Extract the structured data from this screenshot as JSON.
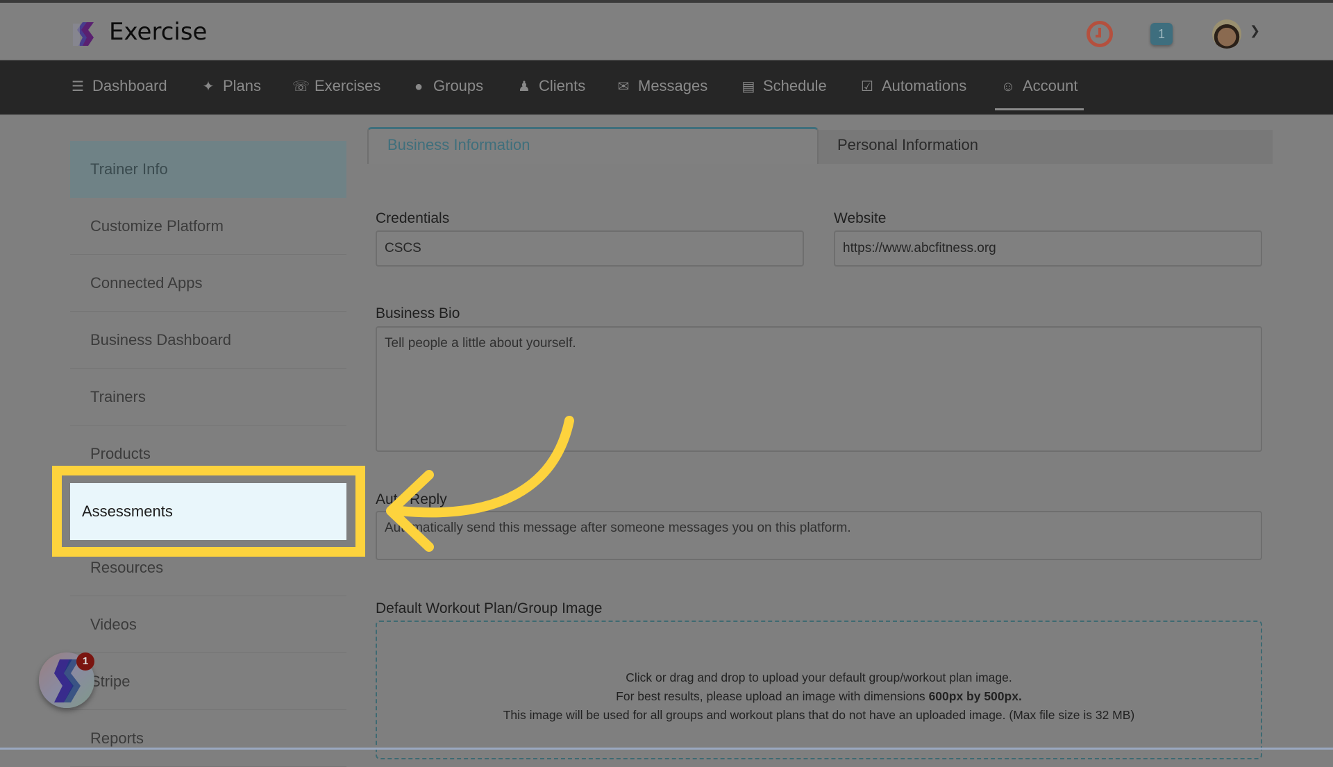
{
  "app": {
    "brand": "Exercise",
    "notification_count": "1",
    "accent": "#3f6f7c",
    "highlight_color": "#fdd33d"
  },
  "nav": {
    "items": [
      {
        "label": "Dashboard",
        "icon": "list-icon"
      },
      {
        "label": "Plans",
        "icon": "twitter-bird-icon"
      },
      {
        "label": "Exercises",
        "icon": "phone-icon"
      },
      {
        "label": "Groups",
        "icon": "users-icon"
      },
      {
        "label": "Clients",
        "icon": "user-icon"
      },
      {
        "label": "Messages",
        "icon": "envelope-icon"
      },
      {
        "label": "Schedule",
        "icon": "book-icon"
      },
      {
        "label": "Automations",
        "icon": "check-square-icon"
      },
      {
        "label": "Account",
        "icon": "user-circle-icon"
      }
    ],
    "active": "Account"
  },
  "sidebar": {
    "items": [
      {
        "label": "Trainer Info"
      },
      {
        "label": "Customize Platform"
      },
      {
        "label": "Connected Apps"
      },
      {
        "label": "Business Dashboard"
      },
      {
        "label": "Trainers"
      },
      {
        "label": "Products"
      },
      {
        "label": "Assessments"
      },
      {
        "label": "Resources"
      },
      {
        "label": "Videos"
      },
      {
        "label": "Stripe"
      },
      {
        "label": "Reports"
      }
    ],
    "highlighted": "Assessments"
  },
  "tabs": {
    "business": "Business Information",
    "personal": "Personal Information"
  },
  "form": {
    "credentials_label": "Credentials",
    "credentials_value": "CSCS",
    "website_label": "Website",
    "website_value": "https://www.abcfitness.org",
    "bio_label": "Business Bio",
    "bio_placeholder": "Tell people a little about yourself.",
    "autoreply_label": "Auto Reply",
    "autoreply_placeholder": "Automatically send this message after someone messages you on this platform.",
    "image_label": "Default Workout Plan/Group Image",
    "upload_line1": "Click or drag and drop to upload your default group/workout plan image.",
    "upload_line2_prefix": "For best results, please upload an image with dimensions ",
    "upload_line2_bold": "600px by 500px.",
    "upload_line3": "This image will be used for all groups and workout plans that do not have an uploaded image. (Max file size is 32 MB)"
  },
  "fab": {
    "badge": "1"
  }
}
